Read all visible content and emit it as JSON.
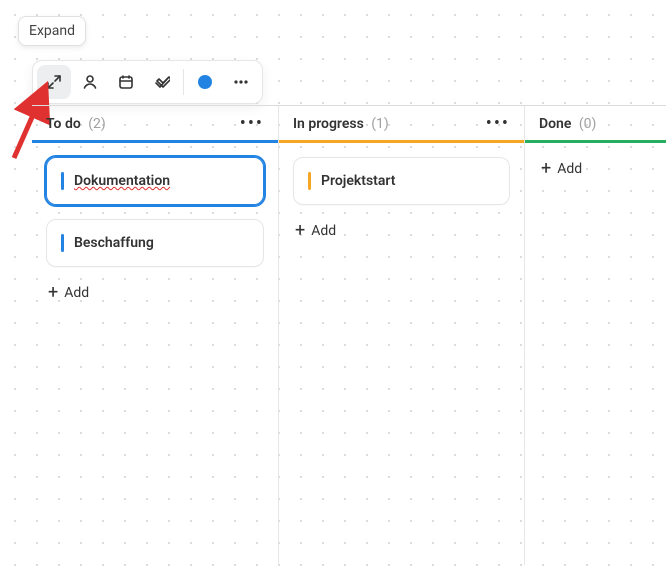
{
  "tooltip": {
    "expand": "Expand"
  },
  "toolbar": {
    "expand_icon": "expand-icon",
    "person_icon": "person-icon",
    "calendar_icon": "calendar-icon",
    "check_icon": "check-icon",
    "color_dot": "#2383e2",
    "more_icon": "more-icon"
  },
  "columns": [
    {
      "id": "todo",
      "title": "To do",
      "count": "(2)",
      "accent": "#2383e2",
      "cards": [
        {
          "title": "Dokumentation",
          "bar": "blue",
          "selected": true,
          "spellcheck": true
        },
        {
          "title": "Beschaffung",
          "bar": "blue",
          "selected": false,
          "spellcheck": false
        }
      ],
      "add_label": "Add",
      "show_menu": true
    },
    {
      "id": "inprogress",
      "title": "In progress",
      "count": "(1)",
      "accent": "#f5a623",
      "cards": [
        {
          "title": "Projektstart",
          "bar": "orange",
          "selected": false,
          "spellcheck": false
        }
      ],
      "add_label": "Add",
      "show_menu": true
    },
    {
      "id": "done",
      "title": "Done",
      "count": "(0)",
      "accent": "#27ae60",
      "cards": [],
      "add_label": "Add",
      "show_menu": false
    }
  ]
}
